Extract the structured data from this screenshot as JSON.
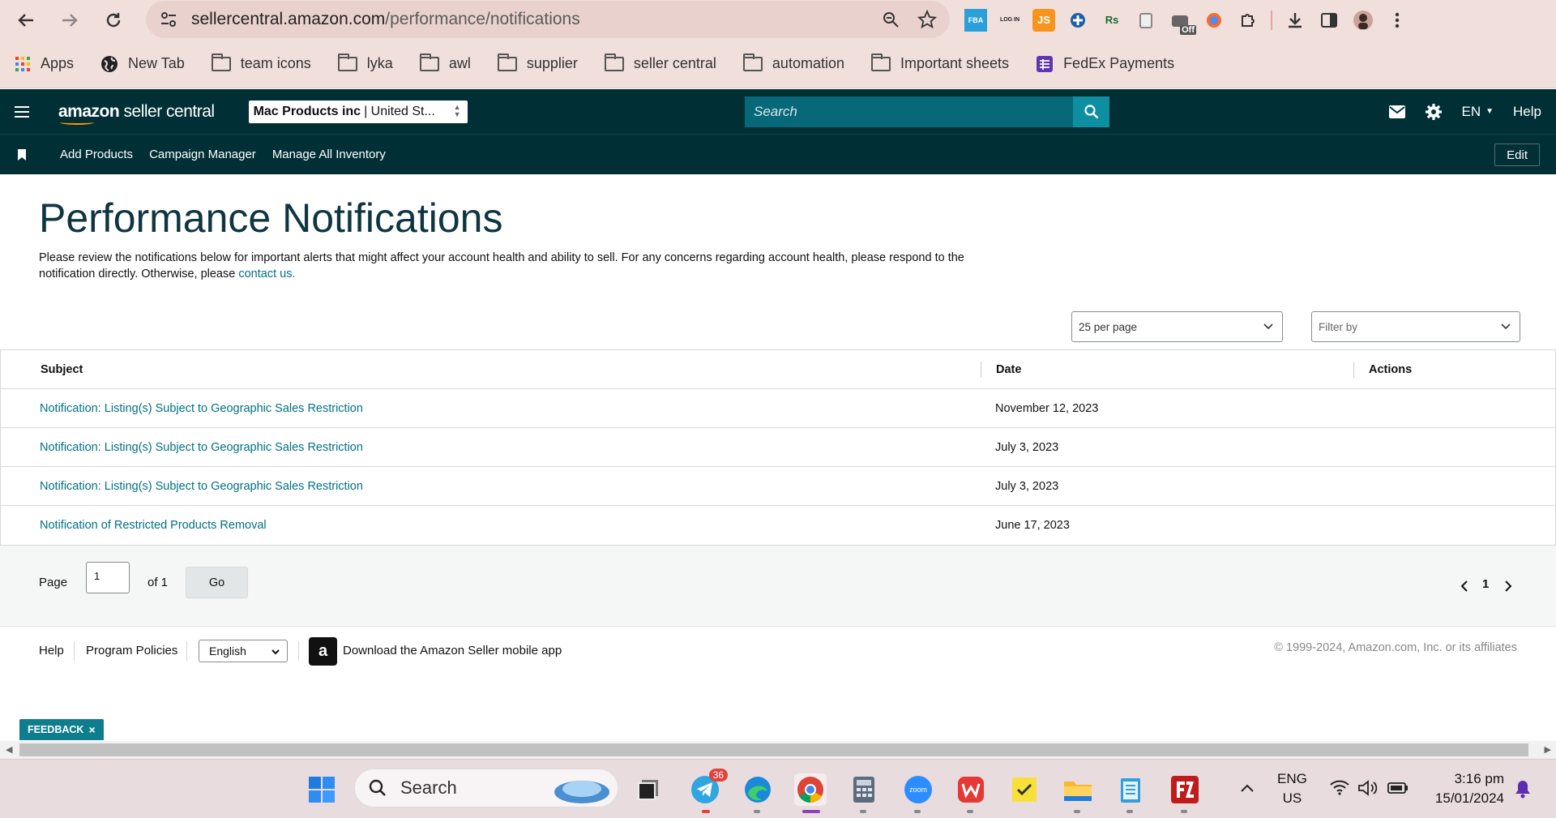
{
  "browser": {
    "url_host": "sellercentral.amazon.com",
    "url_path": "/performance/notifications",
    "bookmarks": [
      {
        "label": "Apps",
        "icon": "apps-grid-icon"
      },
      {
        "label": "New Tab",
        "icon": "globe-icon"
      },
      {
        "label": "team icons",
        "icon": "folder-icon"
      },
      {
        "label": "lyka",
        "icon": "folder-icon"
      },
      {
        "label": "awl",
        "icon": "folder-icon"
      },
      {
        "label": "supplier",
        "icon": "folder-icon"
      },
      {
        "label": "seller central",
        "icon": "folder-icon"
      },
      {
        "label": "automation",
        "icon": "folder-icon"
      },
      {
        "label": "Important sheets",
        "icon": "folder-icon"
      },
      {
        "label": "FedEx Payments",
        "icon": "sheets-icon"
      }
    ],
    "extensions": {
      "fba": "FBA",
      "login": "LOG IN",
      "js": "JS",
      "rs": "Rs",
      "off_badge": "Off"
    }
  },
  "header": {
    "logo_bold": "amazon",
    "logo_rest": " seller central",
    "marketplace_name": "Mac Products inc",
    "marketplace_region": "| United St...",
    "search_placeholder": "Search",
    "language": "EN",
    "help": "Help"
  },
  "subnav": {
    "links": [
      "Add Products",
      "Campaign Manager",
      "Manage All Inventory"
    ],
    "edit_label": "Edit"
  },
  "main": {
    "title": "Performance Notifications",
    "description": "Please review the notifications below for important alerts that might affect your account health and ability to sell. For any concerns regarding account health, please respond to the notification directly. Otherwise, please ",
    "contact_link": "contact us.",
    "per_page": "25 per page",
    "filter_by": "Filter by",
    "columns": [
      "Subject",
      "Date",
      "Actions"
    ],
    "rows": [
      {
        "subject": "Notification: Listing(s) Subject to Geographic Sales Restriction",
        "date": "November 12, 2023"
      },
      {
        "subject": "Notification: Listing(s) Subject to Geographic Sales Restriction",
        "date": "July 3, 2023"
      },
      {
        "subject": "Notification: Listing(s) Subject to Geographic Sales Restriction",
        "date": "July 3, 2023"
      },
      {
        "subject": "Notification of Restricted Products Removal",
        "date": "June 17, 2023"
      }
    ]
  },
  "pagination": {
    "page_label": "Page",
    "page_value": "1",
    "of_label": "of 1",
    "go_label": "Go",
    "current_page": "1"
  },
  "footer": {
    "help": "Help",
    "program_policies": "Program Policies",
    "language": "English",
    "app_text": "Download the Amazon Seller mobile app",
    "copyright": "© 1999-2024, Amazon.com, Inc. or its affiliates",
    "feedback": "FEEDBACK"
  },
  "taskbar": {
    "search": "Search",
    "telegram_badge": "36",
    "zoom_label": "zoom",
    "lang_line1": "ENG",
    "lang_line2": "US",
    "time": "3:16 pm",
    "date": "15/01/2024"
  },
  "colors": {
    "header_bg": "#002f36",
    "link": "#007185",
    "accent_teal": "#0e7e8f",
    "chrome_bg": "#f1dfdb"
  }
}
